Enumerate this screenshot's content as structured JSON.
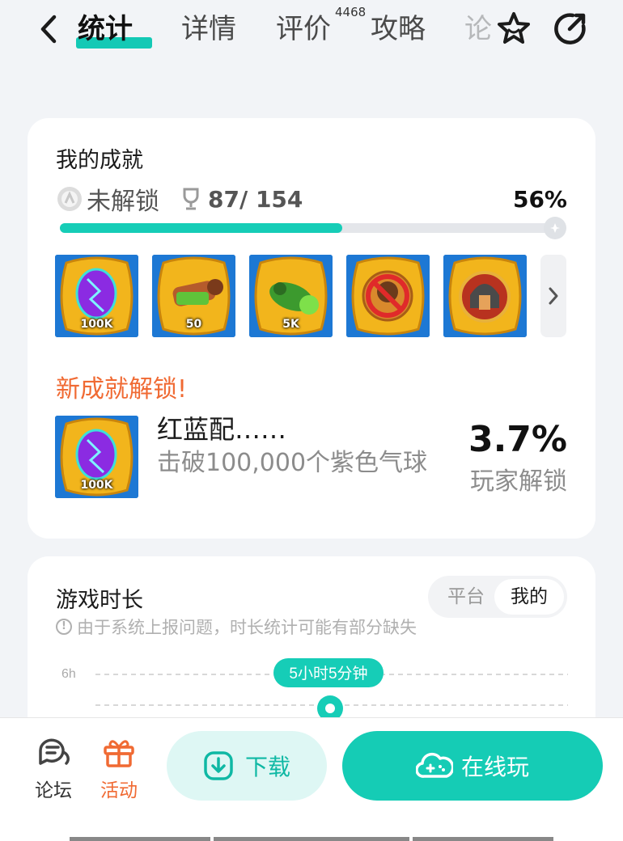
{
  "nav": {
    "tabs": [
      {
        "label": "统计",
        "active": true
      },
      {
        "label": "详情"
      },
      {
        "label": "评价",
        "badge": "4468"
      },
      {
        "label": "攻略"
      },
      {
        "label": "论"
      }
    ],
    "icons": [
      "back-icon",
      "star-icon",
      "share-icon"
    ]
  },
  "achievements": {
    "title": "我的成就",
    "locked_label": "未解锁",
    "count": "87/ 154",
    "percent": "56%",
    "progress": 0.56,
    "badges": [
      {
        "name": "purple-balloon-badge",
        "label": "100K"
      },
      {
        "name": "cannon-badge",
        "label": "50"
      },
      {
        "name": "green-bomb-badge",
        "label": "5K"
      },
      {
        "name": "no-monkey-badge",
        "label": ""
      },
      {
        "name": "spartan-helmet-badge",
        "label": ""
      }
    ],
    "new_unlock": {
      "heading": "新成就解锁!",
      "badge_label": "100K",
      "name": "红蓝配……",
      "description": "击破100,000个紫色气球",
      "percent": "3.7%",
      "percent_label": "玩家解锁"
    }
  },
  "playtime": {
    "title": "游戏时长",
    "note": "由于系统上报问题，时长统计可能有部分缺失",
    "toggle": [
      "平台",
      "我的"
    ],
    "toggle_selected": "我的",
    "y_tick": "6h",
    "tooltip": "5小时5分钟"
  },
  "bottom": {
    "forum": "论坛",
    "activity": "活动",
    "download": "下载",
    "play_online": "在线玩"
  },
  "colors": {
    "accent": "#15ccb5",
    "orange": "#f06a33"
  }
}
